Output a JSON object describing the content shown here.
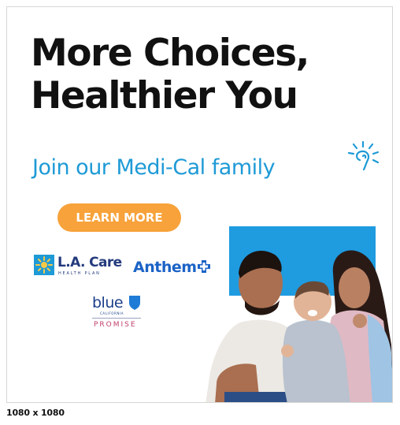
{
  "ad": {
    "headline_line1": "More Choices,",
    "headline_line2": "Healthier You",
    "tagline": "Join our Medi-Cal family",
    "cta_label": "LEARN MORE",
    "colors": {
      "headline": "#111111",
      "tagline": "#1e9ad6",
      "cta_background": "#f7a23a",
      "cta_text": "#ffffff",
      "photo_backdrop": "#1f9be0"
    },
    "icons": [
      "sun-icon",
      "lacare-sun-logo-icon",
      "anthem-cross-icon",
      "blue-shield-icon"
    ]
  },
  "logos": {
    "lacare": {
      "name": "L.A. Care",
      "subtitle": "HEALTH PLAN"
    },
    "anthem": {
      "name": "Anthem"
    },
    "blue_shield_promise": {
      "word": "blue",
      "state": "CALIFORNIA",
      "program": "PROMISE"
    }
  },
  "footer": {
    "size_label": "1080 x 1080"
  }
}
